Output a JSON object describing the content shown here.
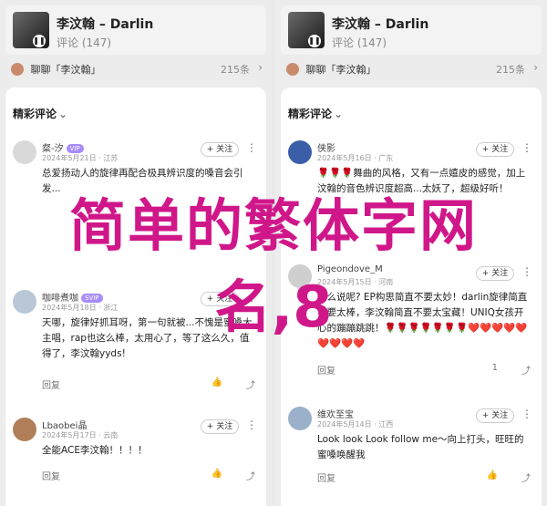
{
  "left": {
    "player": {
      "title": "李汶翰 – Darlin",
      "sub": "评论 (147)",
      "play_icon": "pause-icon"
    },
    "chat": {
      "text": "聊聊「李汶翰」",
      "count": "215条",
      "chevron": "›"
    },
    "sheet_head": {
      "label": "精彩评论",
      "dropdown": "⌄"
    },
    "comments": [
      {
        "name": "粲-汐",
        "vip": "VIP",
        "date": "2024年5月21日 · 江苏",
        "follow": "+ 关注",
        "text": "总爱扬动人的旋律再配合极具辨识度的嗓音会引发...",
        "reply": "回复",
        "like": "👍",
        "share": "⤴",
        "avatar_color": "#d9d9d9"
      },
      {
        "name": "咖啡煮咖",
        "vip": "SVIP",
        "date": "2024年5月18日 · 浙江",
        "follow": "+ 关注",
        "text": "天哪，旋律好抓耳呀，第一句就被...不愧是蜜嗓大主唱，rap也这么棒，太用心了，等了这么久，值得了，李汶翰yyds!",
        "reply": "回复",
        "like": "👍",
        "share": "⤴",
        "avatar_color": "#b9c7d6"
      },
      {
        "name": "Lbaobei晶",
        "vip": "",
        "date": "2024年5月17日 · 云南",
        "follow": "+ 关注",
        "text": "全能ACE李汶翰！！！！",
        "reply": "回复",
        "like": "👍",
        "share": "⤴",
        "avatar_color": "#b07f5a"
      }
    ]
  },
  "right": {
    "player": {
      "title": "李汶翰 – Darlin",
      "sub": "评论 (147)",
      "play_icon": "pause-icon"
    },
    "chat": {
      "text": "聊聊「李汶翰」",
      "count": "215条",
      "chevron": "›"
    },
    "sheet_head": {
      "label": "精彩评论",
      "dropdown": "⌄"
    },
    "comments": [
      {
        "name": "侠影",
        "vip": "",
        "date": "2024年5月16日 · 广东",
        "follow": "+ 关注",
        "text": "🌹🌹🌹舞曲的风格，又有一点嬉皮的感觉，加上汶翰的音色辨识度超高...太妖了，超级好听！",
        "reply": "回复",
        "like": "👍",
        "share": "⤴",
        "avatar_color": "#3b5ea8"
      },
      {
        "name": "Pigeondove_M",
        "vip": "",
        "date": "2024年5月15日 · 河南",
        "follow": "+ 关注",
        "text": "怎么说呢? EP构思简直不要太妙！darlin旋律简直不要太棒，李汶翰简直不要太宝藏！UNIQ女孩开心的蹦蹦跳跳！🌹🌹🌹🌹🌹🌹🌹❤️❤️❤️❤️❤️❤️❤️❤️❤️",
        "reply": "回复",
        "like": "1",
        "share": "⤴",
        "avatar_color": "#cfcfcf"
      },
      {
        "name": "维欢至宝",
        "vip": "",
        "date": "2024年5月14日 · 江西",
        "follow": "+ 关注",
        "text": "Look look Look follow me～向上打头，旺旺的蜜嗓唤醒我",
        "reply": "回复",
        "like": "👍",
        "share": "⤴",
        "avatar_color": "#9bb0c9"
      }
    ]
  },
  "watermark": {
    "line1": "简单的繁体字网",
    "line2": "名,8"
  }
}
